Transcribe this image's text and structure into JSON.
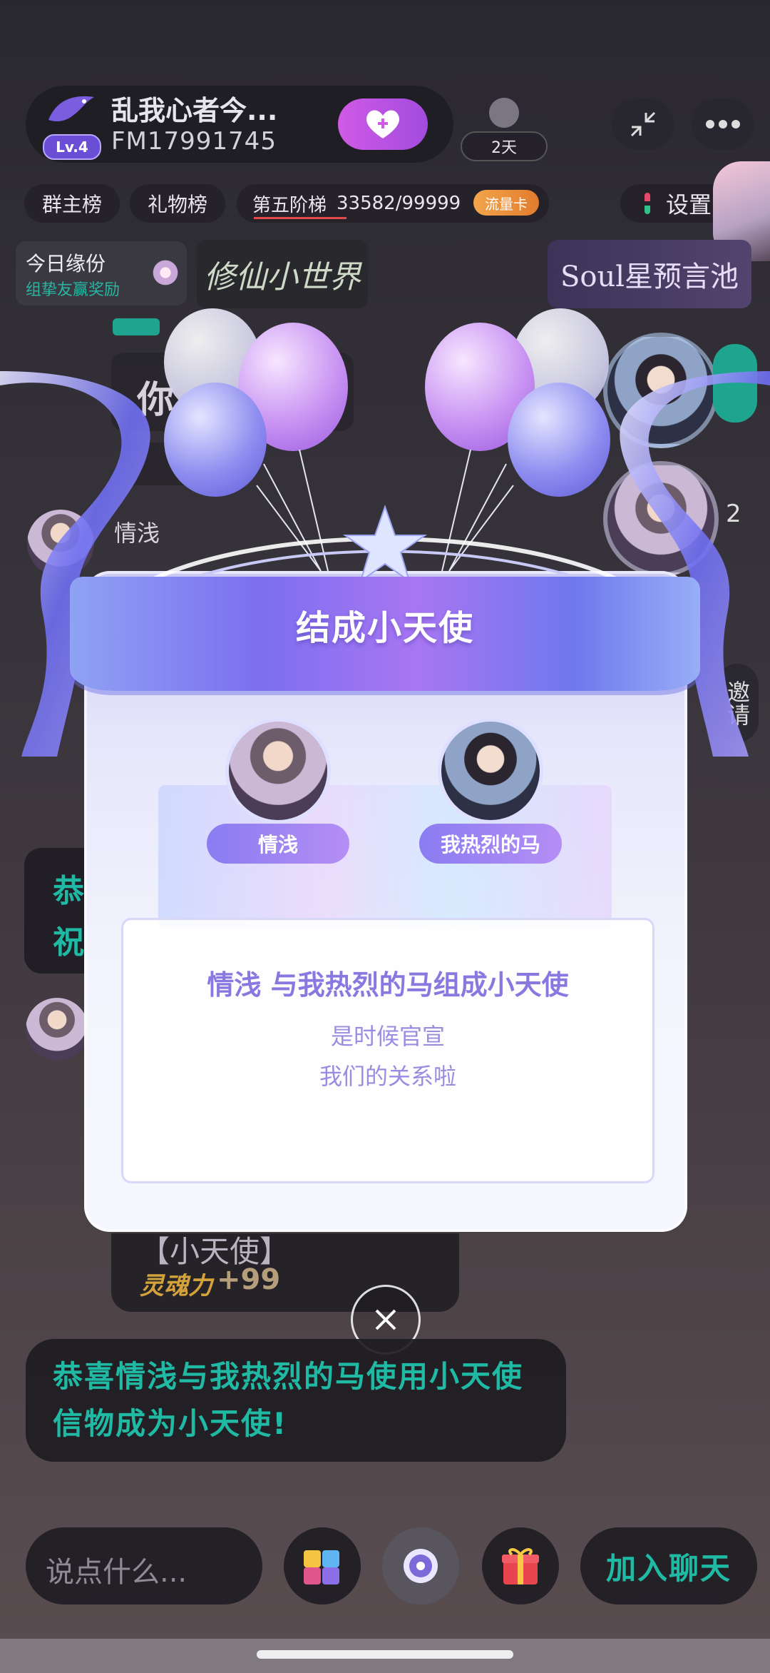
{
  "room": {
    "title": "乱我心者今...",
    "fm_id": "FM17991745",
    "level": "Lv.4",
    "days": "2天"
  },
  "tags": {
    "group_rank": "群主榜",
    "gift_rank": "礼物榜",
    "ladder_label": "第五阶梯",
    "ladder_progress": "33582/99999",
    "traffic_card": "流量卡",
    "settings": "设置"
  },
  "promo": {
    "fate_title": "今日缘份",
    "fate_sub": "组挚友赢奖励",
    "xiuxian": "修仙小世界",
    "soul": "Soul星预言池"
  },
  "side": {
    "invite": "邀请",
    "count": "2"
  },
  "modal": {
    "title": "结成小天使",
    "user_left": "情浅",
    "user_right": "我热烈的马",
    "main_line": "情浅 与我热烈的马组成小天使",
    "line2": "是时候官宣",
    "line3": "我们的关系啦"
  },
  "background_chat": {
    "partial_name": "情浅",
    "partial_congrats": "恭",
    "partial_bless": "祝",
    "partial_you": "你",
    "angel_text": "【小天使】",
    "soul_power_label": "灵魂力",
    "soul_power_value": "+99",
    "congrats_message": "恭喜情浅与我热烈的马使用小天使信物成为小天使!"
  },
  "bottom_bar": {
    "input_placeholder": "说点什么...",
    "join_label": "加入聊天"
  },
  "colors": {
    "accent_teal": "#1fb9a4",
    "modal_purple": "#8a7cf2",
    "text_purple": "#8877e0"
  }
}
